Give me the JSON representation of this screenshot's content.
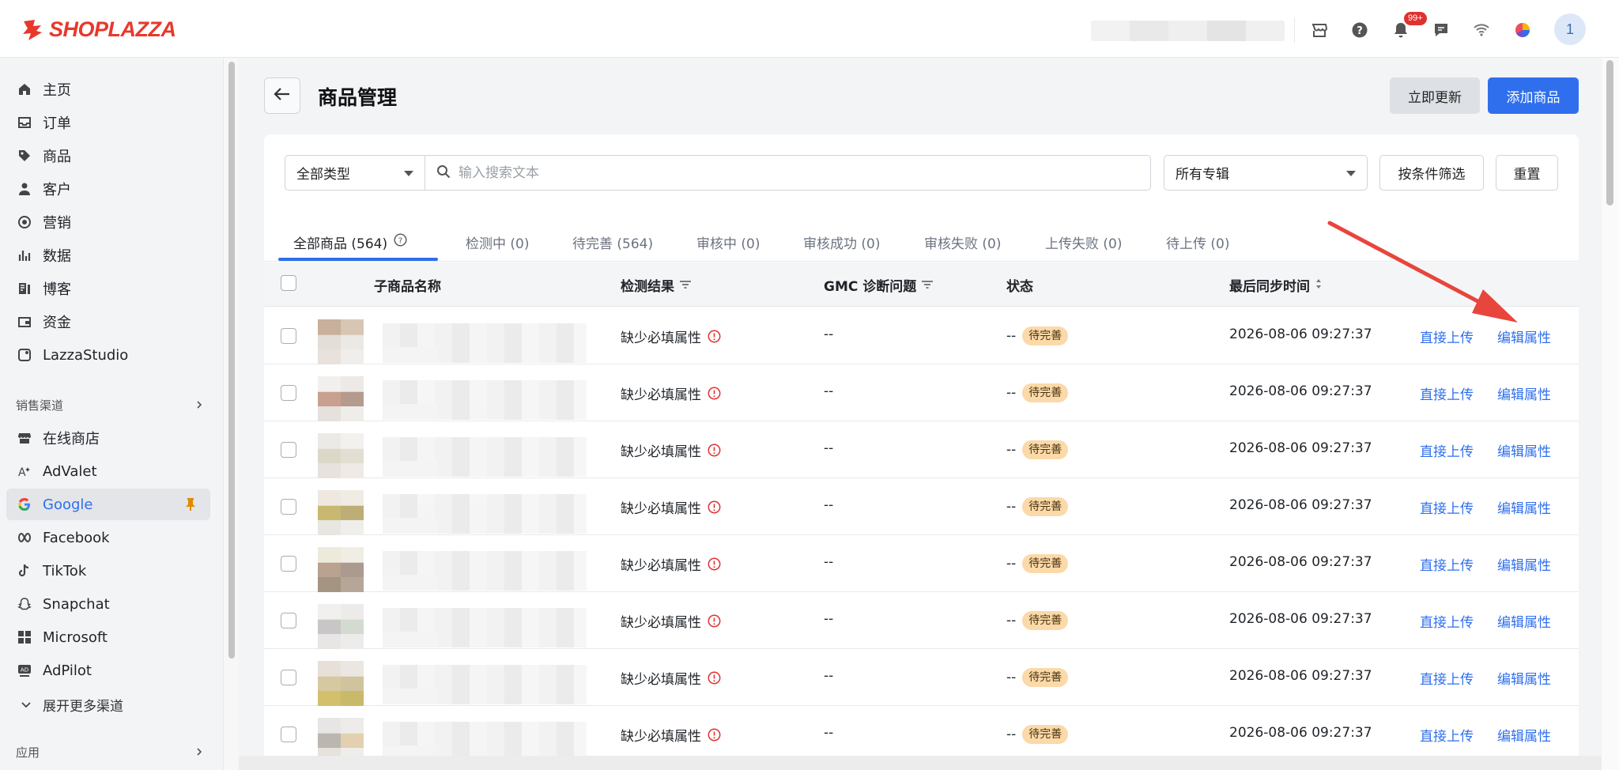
{
  "app": {
    "logo_text": "SHOPLAZZA",
    "notification_badge": "99+",
    "avatar_label": "1"
  },
  "sidebar": {
    "items": [
      {
        "label": "主页",
        "icon": "home-icon"
      },
      {
        "label": "订单",
        "icon": "inbox-icon"
      },
      {
        "label": "商品",
        "icon": "tag-icon"
      },
      {
        "label": "客户",
        "icon": "user-icon"
      },
      {
        "label": "营销",
        "icon": "target-icon"
      },
      {
        "label": "数据",
        "icon": "bar-chart-icon"
      },
      {
        "label": "博客",
        "icon": "blog-icon"
      },
      {
        "label": "资金",
        "icon": "wallet-icon"
      },
      {
        "label": "LazzaStudio",
        "icon": "studio-icon"
      }
    ],
    "channels_heading": "销售渠道",
    "channels": [
      {
        "label": "在线商店",
        "icon": "store-icon"
      },
      {
        "label": "AdValet",
        "icon": "advalet-icon"
      },
      {
        "label": "Google",
        "icon": "google-icon",
        "active": true
      },
      {
        "label": "Facebook",
        "icon": "meta-icon"
      },
      {
        "label": "TikTok",
        "icon": "tiktok-icon"
      },
      {
        "label": "Snapchat",
        "icon": "snapchat-icon"
      },
      {
        "label": "Microsoft",
        "icon": "microsoft-icon"
      },
      {
        "label": "AdPilot",
        "icon": "adpilot-icon"
      }
    ],
    "expand_more": "展开更多渠道",
    "apps_heading": "应用"
  },
  "header": {
    "title": "商品管理",
    "update_button": "立即更新",
    "add_button": "添加商品"
  },
  "filters": {
    "type_select": "全部类型",
    "search_placeholder": "输入搜索文本",
    "collection_select": "所有专辑",
    "filter_button": "按条件筛选",
    "reset_button": "重置"
  },
  "tabs": [
    {
      "label": "全部商品 (564)"
    },
    {
      "label": "检测中 (0)"
    },
    {
      "label": "待完善 (564)"
    },
    {
      "label": "审核中 (0)"
    },
    {
      "label": "审核成功 (0)"
    },
    {
      "label": "审核失败 (0)"
    },
    {
      "label": "上传失败 (0)"
    },
    {
      "label": "待上传 (0)"
    }
  ],
  "table": {
    "columns": {
      "name": "子商品名称",
      "result": "检测结果",
      "gmc": "GMC 诊断问题",
      "status": "状态",
      "synced": "最后同步时间"
    },
    "rows": [
      {
        "result": "缺少必填属性",
        "gmc": "--",
        "status_dash": "--",
        "status_tag": "待完善",
        "synced": "2026-08-06 09:27:37",
        "action_upload": "直接上传",
        "action_edit": "编辑属性"
      },
      {
        "result": "缺少必填属性",
        "gmc": "--",
        "status_dash": "--",
        "status_tag": "待完善",
        "synced": "2026-08-06 09:27:37",
        "action_upload": "直接上传",
        "action_edit": "编辑属性"
      },
      {
        "result": "缺少必填属性",
        "gmc": "--",
        "status_dash": "--",
        "status_tag": "待完善",
        "synced": "2026-08-06 09:27:37",
        "action_upload": "直接上传",
        "action_edit": "编辑属性"
      },
      {
        "result": "缺少必填属性",
        "gmc": "--",
        "status_dash": "--",
        "status_tag": "待完善",
        "synced": "2026-08-06 09:27:37",
        "action_upload": "直接上传",
        "action_edit": "编辑属性"
      },
      {
        "result": "缺少必填属性",
        "gmc": "--",
        "status_dash": "--",
        "status_tag": "待完善",
        "synced": "2026-08-06 09:27:37",
        "action_upload": "直接上传",
        "action_edit": "编辑属性"
      },
      {
        "result": "缺少必填属性",
        "gmc": "--",
        "status_dash": "--",
        "status_tag": "待完善",
        "synced": "2026-08-06 09:27:37",
        "action_upload": "直接上传",
        "action_edit": "编辑属性"
      },
      {
        "result": "缺少必填属性",
        "gmc": "--",
        "status_dash": "--",
        "status_tag": "待完善",
        "synced": "2026-08-06 09:27:37",
        "action_upload": "直接上传",
        "action_edit": "编辑属性"
      },
      {
        "result": "缺少必填属性",
        "gmc": "--",
        "status_dash": "--",
        "status_tag": "待完善",
        "synced": "2026-08-06 09:27:37",
        "action_upload": "直接上传",
        "action_edit": "编辑属性"
      }
    ]
  },
  "colors": {
    "accent": "#2f6fed",
    "brand": "#e8382b",
    "pending_tag": "#fbd9a8",
    "error": "#e03131",
    "annotation_arrow": "#e8453c"
  }
}
